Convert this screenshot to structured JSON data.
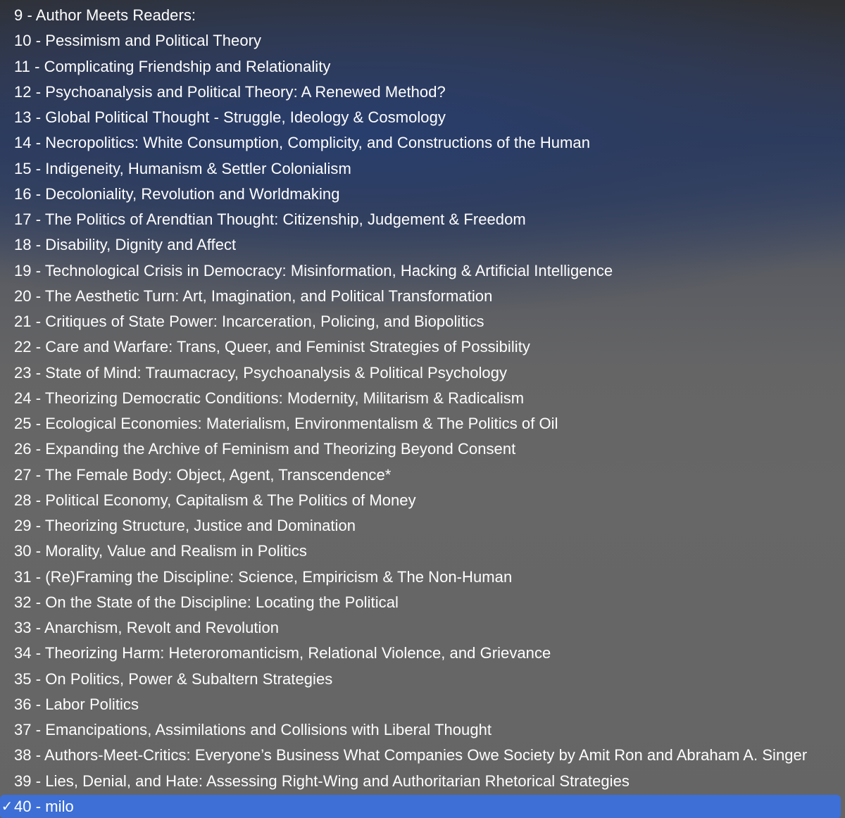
{
  "menu": {
    "items": [
      {
        "label": "9 - Author Meets Readers:"
      },
      {
        "label": "10 - Pessimism and Political Theory"
      },
      {
        "label": "11 - Complicating Friendship and Relationality"
      },
      {
        "label": "12 - Psychoanalysis and Political Theory: A Renewed Method?"
      },
      {
        "label": "13 - Global Political Thought - Struggle, Ideology & Cosmology"
      },
      {
        "label": "14 - Necropolitics: White Consumption, Complicity, and Constructions of the Human"
      },
      {
        "label": "15 - Indigeneity, Humanism & Settler Colonialism"
      },
      {
        "label": "16 - Decoloniality, Revolution and Worldmaking"
      },
      {
        "label": "17 - The Politics of Arendtian Thought: Citizenship, Judgement & Freedom"
      },
      {
        "label": "18 - Disability, Dignity and Affect"
      },
      {
        "label": "19 - Technological Crisis in Democracy: Misinformation, Hacking & Artificial Intelligence"
      },
      {
        "label": "20 - The Aesthetic Turn: Art, Imagination, and Political Transformation"
      },
      {
        "label": "21 - Critiques of State Power: Incarceration, Policing, and Biopolitics"
      },
      {
        "label": "22 - Care and Warfare: Trans, Queer, and Feminist Strategies of Possibility"
      },
      {
        "label": "23 - State of Mind: Traumacracy, Psychoanalysis & Political Psychology"
      },
      {
        "label": "24 - Theorizing Democratic Conditions: Modernity, Militarism & Radicalism"
      },
      {
        "label": "25 - Ecological Economies: Materialism, Environmentalism & The Politics of Oil"
      },
      {
        "label": "26 - Expanding the Archive of Feminism and Theorizing Beyond Consent"
      },
      {
        "label": "27 - The Female Body: Object, Agent, Transcendence*"
      },
      {
        "label": "28 - Political Economy, Capitalism & The Politics of Money"
      },
      {
        "label": "29 - Theorizing Structure, Justice and Domination"
      },
      {
        "label": "30 - Morality, Value and Realism in Politics"
      },
      {
        "label": "31 - (Re)Framing the Discipline: Science, Empiricism & The Non-Human"
      },
      {
        "label": "32 - On the State of the Discipline: Locating the Political"
      },
      {
        "label": "33 - Anarchism, Revolt and Revolution"
      },
      {
        "label": "34 - Theorizing Harm: Heteroromanticism, Relational Violence, and Grievance"
      },
      {
        "label": "35 - On Politics, Power & Subaltern Strategies"
      },
      {
        "label": "36 - Labor Politics"
      },
      {
        "label": "37 - Emancipations, Assimilations and Collisions with Liberal Thought"
      },
      {
        "label": "38 - Authors-Meet-Critics: Everyone’s Business What Companies Owe Society by Amit Ron and Abraham A. Singer"
      },
      {
        "label": "39 - Lies, Denial, and Hate: Assessing Right-Wing and Authoritarian Rhetorical Strategies"
      },
      {
        "label": "40 - milo",
        "selected": true
      }
    ],
    "check_glyph": "✓",
    "selected_color": "#3d6fd6"
  }
}
